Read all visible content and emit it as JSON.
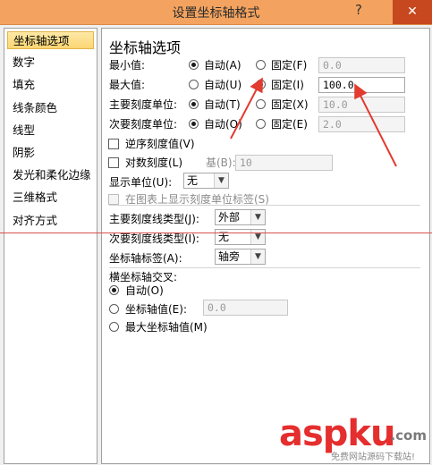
{
  "window": {
    "title": "设置坐标轴格式",
    "help": "?",
    "close": "✕"
  },
  "sidebar": {
    "items": [
      {
        "label": "坐标轴选项",
        "active": true
      },
      {
        "label": "数字"
      },
      {
        "label": "填充"
      },
      {
        "label": "线条颜色"
      },
      {
        "label": "线型"
      },
      {
        "label": "阴影"
      },
      {
        "label": "发光和柔化边缘"
      },
      {
        "label": "三维格式"
      },
      {
        "label": "对齐方式"
      }
    ]
  },
  "panel": {
    "heading": "坐标轴选项",
    "rows": [
      {
        "label": "最小值:",
        "auto": "自动(A)",
        "fixed": "固定(F)",
        "value": "0.0",
        "selected": "auto"
      },
      {
        "label": "最大值:",
        "auto": "自动(U)",
        "fixed": "固定(I)",
        "value": "100.0",
        "selected": "fixed"
      },
      {
        "label": "主要刻度单位:",
        "auto": "自动(T)",
        "fixed": "固定(X)",
        "value": "10.0",
        "selected": "auto"
      },
      {
        "label": "次要刻度单位:",
        "auto": "自动(O)",
        "fixed": "固定(E)",
        "value": "2.0",
        "selected": "auto"
      }
    ],
    "reverse_label": "逆序刻度值(V)",
    "log_label": "对数刻度(L)",
    "base_label": "基(B):",
    "base_value": "10",
    "display_units_label": "显示单位(U):",
    "display_units_value": "无",
    "show_units_label": "在图表上显示刻度单位标签(S)",
    "major_tick_label": "主要刻度线类型(J):",
    "major_tick_value": "外部",
    "minor_tick_label": "次要刻度线类型(I):",
    "minor_tick_value": "无",
    "axis_labels_label": "坐标轴标签(A):",
    "axis_labels_value": "轴旁",
    "cross_label": "横坐标轴交叉:",
    "cross_auto": "自动(O)",
    "cross_value_label": "坐标轴值(E):",
    "cross_value": "0.0",
    "cross_max": "最大坐标轴值(M)"
  },
  "watermark": {
    "brand": "aspku",
    "domain": ".com",
    "sub": "免费网站源码下载站!"
  }
}
